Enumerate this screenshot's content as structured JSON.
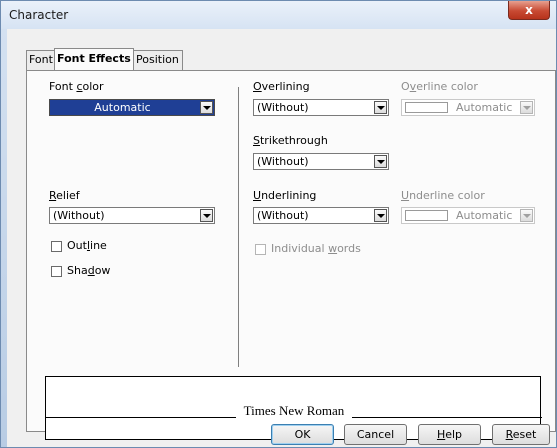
{
  "window": {
    "title": "Character",
    "close_glyph": "x",
    "accent_color": "#1f3f95"
  },
  "tabs": [
    {
      "label": "Font"
    },
    {
      "label": "Font Effects"
    },
    {
      "label": "Position"
    }
  ],
  "font_color": {
    "label_pre": "Font ",
    "label_u": "c",
    "label_post": "olor",
    "value": "Automatic"
  },
  "relief": {
    "label_u": "R",
    "label_post": "elief",
    "value": "(Without)"
  },
  "outline": {
    "label_pre": "Out",
    "label_u": "l",
    "label_post": "ine"
  },
  "shadow": {
    "label_pre": "Sha",
    "label_u": "d",
    "label_post": "ow"
  },
  "overlining": {
    "label_u": "O",
    "label_post": "verlining",
    "value": "(Without)"
  },
  "overline_color": {
    "label_pre": "O",
    "label_u": "v",
    "label_post": "erline color",
    "value": "Automatic"
  },
  "strikethrough": {
    "label_u": "S",
    "label_post": "trikethrough",
    "value": "(Without)"
  },
  "underlining": {
    "label_u": "U",
    "label_post": "nderlining",
    "value": "(Without)"
  },
  "underline_color": {
    "label_u": "U",
    "label_post": "nderline color",
    "value": "Automatic"
  },
  "individual_words": {
    "label_pre": "Individual ",
    "label_u": "w",
    "label_post": "ords"
  },
  "preview": {
    "text": "Times New Roman"
  },
  "buttons": {
    "ok": "OK",
    "cancel": "Cancel",
    "help_u": "H",
    "help_post": "elp",
    "reset_u": "R",
    "reset_post": "eset"
  }
}
